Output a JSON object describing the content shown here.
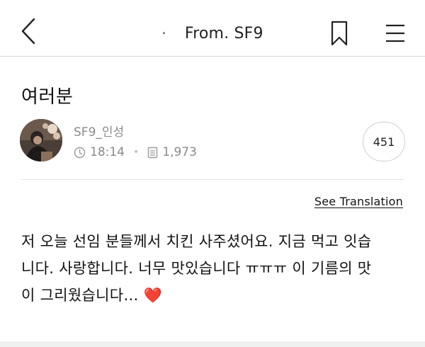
{
  "header": {
    "dot": "·",
    "title": "From. SF9"
  },
  "post": {
    "title": "여러분",
    "author": "SF9_인성",
    "time": "18:14",
    "views": "1,973",
    "comment_count": "451",
    "see_translation": "See Translation",
    "body_lines": [
      "저 오늘 선임 분들께서 치킨 사주셨어요. 지금 먹고 잇습",
      "니다. 사랑합니다. 너무 맛있습니다 ㅠㅠㅠ 이 기름의 맛",
      "이 그리웠습니다… "
    ],
    "emoji": "❤️"
  },
  "icons": {
    "back": "chevron-left-icon",
    "bookmark": "bookmark-icon",
    "menu": "hamburger-menu-icon",
    "clock": "clock-icon",
    "views": "document-icon"
  },
  "colors": {
    "heart": "#e8202f",
    "meta_text": "#8a8a8a"
  }
}
